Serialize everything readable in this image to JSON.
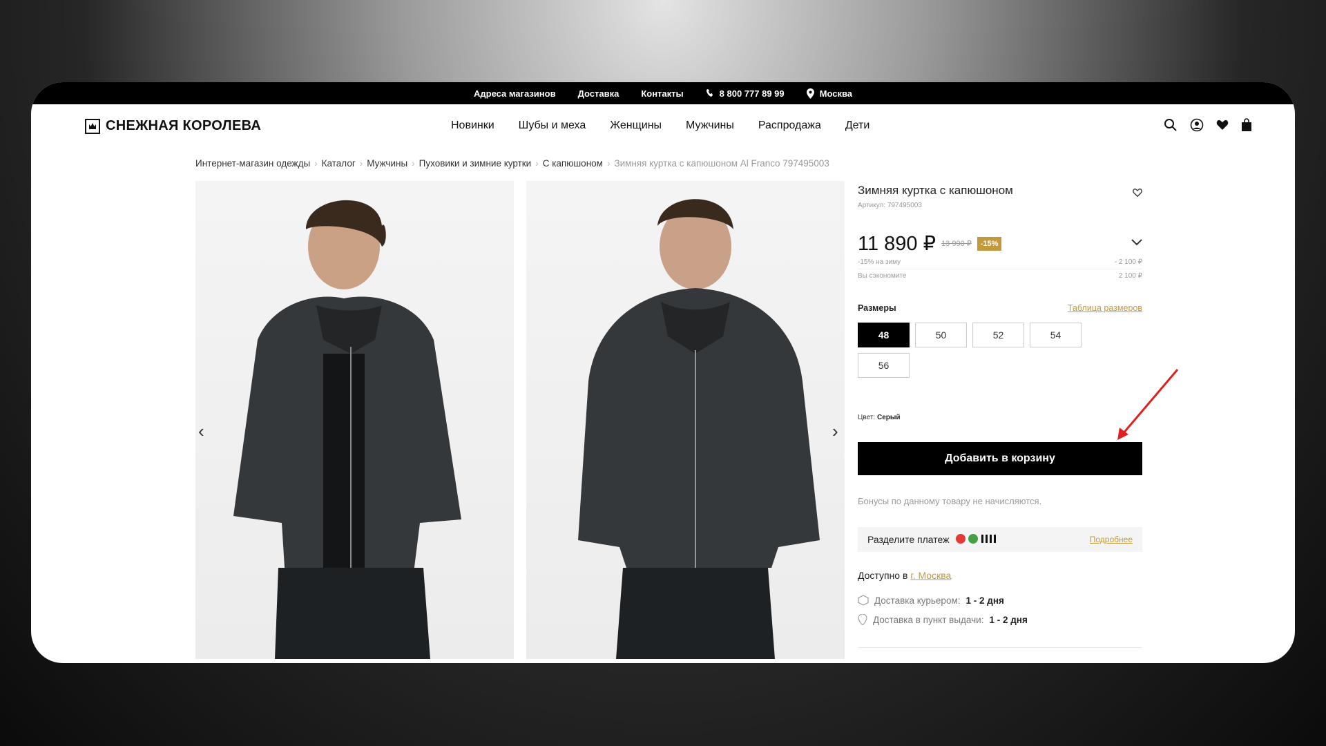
{
  "topbar": {
    "stores": "Адреса магазинов",
    "delivery": "Доставка",
    "contacts": "Контакты",
    "phone": "8 800 777 89 99",
    "city": "Москва"
  },
  "brand": {
    "logo": "СНЕЖНАЯ КОРОЛЕВА"
  },
  "nav": [
    "Новинки",
    "Шубы и меха",
    "Женщины",
    "Мужчины",
    "Распродажа",
    "Дети"
  ],
  "breadcrumbs": [
    "Интернет-магазин одежды",
    "Каталог",
    "Мужчины",
    "Пуховики и зимние куртки",
    "С капюшоном",
    "Зимняя куртка с капюшоном Al Franco 797495003"
  ],
  "product": {
    "title": "Зимняя куртка с капюшоном",
    "sku": "Артикул: 797495003",
    "price": "11 890 ₽",
    "old_price": "13 990 ₽",
    "discount": "-15%",
    "promo_label": "-15% на зиму",
    "promo_value": "- 2 100 ₽",
    "saved_label": "Вы сэкономите",
    "saved_value": "2 100 ₽",
    "sizes_label": "Размеры",
    "size_table": "Таблица размеров",
    "sizes": [
      "48",
      "50",
      "52",
      "54",
      "56"
    ],
    "selected_size": "48",
    "color_label": "Цвет:",
    "color_value": "Серый",
    "add_to_cart": "Добавить в корзину",
    "bonus_note": "Бонусы по данному товару не начисляются.",
    "split_label": "Разделите платеж",
    "split_more": "Подробнее",
    "available_label": "Доступно в",
    "available_city": "г. Москва",
    "courier_label": "Доставка курьером:",
    "courier_value": "1 - 2 дня",
    "pickup_label": "Доставка в пункт выдачи:",
    "pickup_value": "1 - 2 дня"
  },
  "colors": {
    "accent": "#c39a3b",
    "annotation_arrow": "#e02020",
    "black": "#000000"
  },
  "icons": [
    "phone-icon",
    "location-pin-icon",
    "search-icon",
    "account-icon",
    "heart-icon",
    "bag-icon",
    "chevron-left-icon",
    "chevron-right-icon",
    "chevron-down-icon",
    "box-icon"
  ]
}
